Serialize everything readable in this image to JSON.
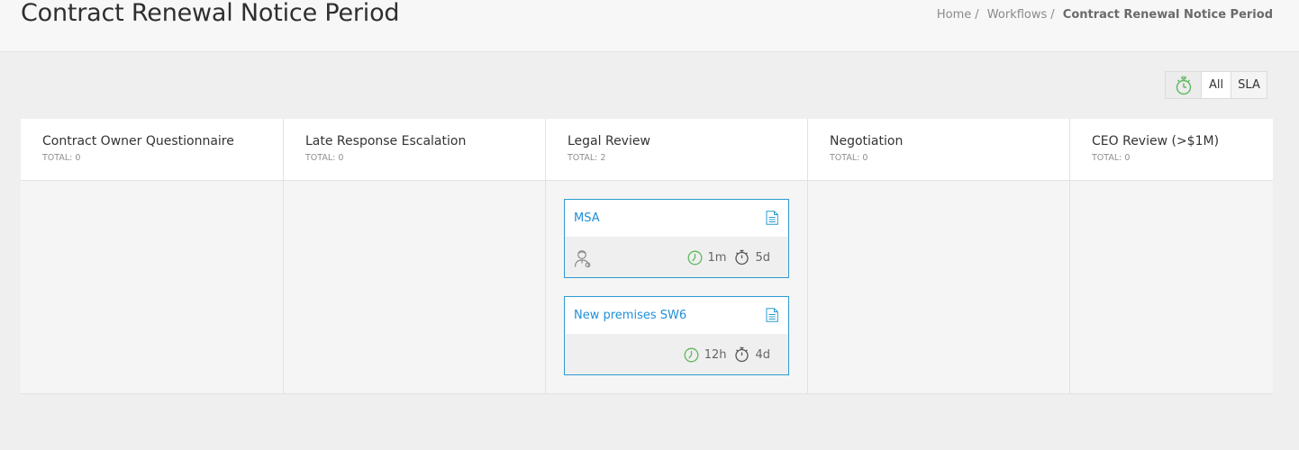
{
  "page": {
    "title": "Contract Renewal Notice Period"
  },
  "breadcrumb": {
    "items": [
      "Home",
      "Workflows"
    ],
    "separator": "/",
    "current": "Contract Renewal Notice Period"
  },
  "filters": {
    "icon": "stopwatch-icon",
    "all_label": "All",
    "sla_label": "SLA"
  },
  "columns": [
    {
      "title": "Contract Owner Questionnaire",
      "total": "TOTAL: 0"
    },
    {
      "title": "Late Response Escalation",
      "total": "TOTAL: 0"
    },
    {
      "title": "Legal Review",
      "total": "TOTAL: 2"
    },
    {
      "title": "Negotiation",
      "total": "TOTAL: 0"
    },
    {
      "title": "CEO Review (>$1M)",
      "total": "TOTAL: 0"
    }
  ],
  "cards": [
    {
      "title": "MSA",
      "elapsed": "1m",
      "sla": "5d",
      "has_assignee": true
    },
    {
      "title": "New premises SW6",
      "elapsed": "12h",
      "sla": "4d",
      "has_assignee": false
    }
  ],
  "colors": {
    "accent": "#2d9bd0",
    "link": "#1f8fd6",
    "timer_green": "#5cb85c"
  }
}
